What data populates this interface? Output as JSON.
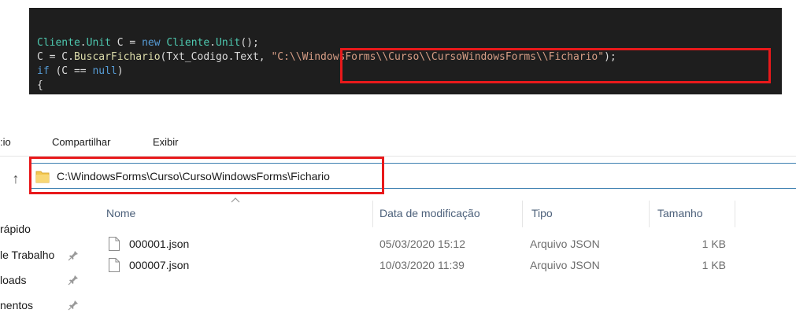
{
  "code": {
    "line1": {
      "type": "Cliente",
      "dot": ".",
      "unit": "Unit",
      "var": " C = ",
      "kw": "new",
      "sp": " ",
      "type2": "Cliente",
      "dot2": ".",
      "unit2": "Unit",
      "end": "();"
    },
    "line2": {
      "lhs": "C = C.",
      "method": "BuscarFichario",
      "open": "(Txt_Codigo.Text, ",
      "string": "\"C:\\\\WindowsForms\\\\Curso\\\\CursoWindowsForms\\\\Fichario\"",
      "close": ");"
    },
    "line3": {
      "kw": "if",
      "rest": " (C == ",
      "null_kw": "null",
      "paren": ")"
    },
    "line4": {
      "brace": "{"
    }
  },
  "ribbon": {
    "tabs": [
      ":io",
      "Compartilhar",
      "Exibir"
    ]
  },
  "address_bar": {
    "path": "C:\\WindowsForms\\Curso\\CursoWindowsForms\\Fichario"
  },
  "nav_pane": {
    "items": [
      {
        "label": "rápido",
        "pinned": false
      },
      {
        "label": "le Trabalho",
        "pinned": true
      },
      {
        "label": "loads",
        "pinned": true
      },
      {
        "label": "nentos",
        "pinned": true
      }
    ]
  },
  "file_list": {
    "columns": [
      "Nome",
      "Data de modificação",
      "Tipo",
      "Tamanho"
    ],
    "rows": [
      {
        "name": "000001.json",
        "date": "05/03/2020 15:12",
        "type": "Arquivo JSON",
        "size": "1 KB"
      },
      {
        "name": "000007.json",
        "date": "10/03/2020 11:39",
        "type": "Arquivo JSON",
        "size": "1 KB"
      }
    ]
  },
  "colors": {
    "highlight_box": "#e8191b",
    "editor_bg": "#1e1e1e",
    "folder_yellow": "#f4c74f"
  }
}
